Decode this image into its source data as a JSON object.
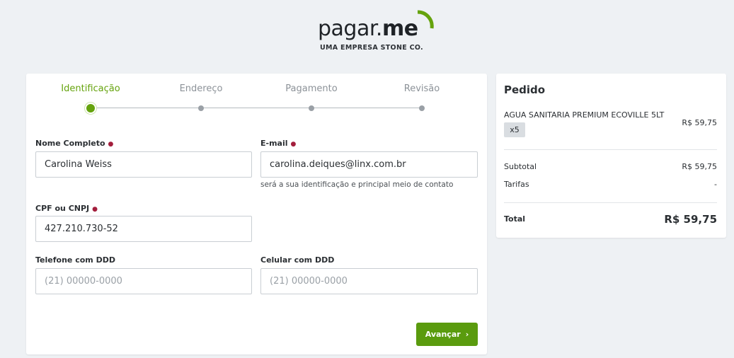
{
  "header": {
    "logo_word_1": "pagar.",
    "logo_word_2": "me",
    "logo_subtitle": "UMA EMPRESA STONE CO."
  },
  "stepper": {
    "steps": [
      {
        "label": "Identificação",
        "active": true
      },
      {
        "label": "Endereço",
        "active": false
      },
      {
        "label": "Pagamento",
        "active": false
      },
      {
        "label": "Revisão",
        "active": false
      }
    ]
  },
  "form": {
    "full_name": {
      "label": "Nome Completo",
      "required_mark": "●",
      "value": "Carolina Weiss"
    },
    "email": {
      "label": "E-mail",
      "required_mark": "●",
      "value": "carolina.deiques@linx.com.br",
      "help": "será a sua identificação e principal meio de contato"
    },
    "cpf": {
      "label": "CPF ou CNPJ",
      "required_mark": "●",
      "value": "427.210.730-52"
    },
    "phone": {
      "label": "Telefone com DDD",
      "value": "",
      "placeholder": "(21) 00000-0000"
    },
    "mobile": {
      "label": "Celular com DDD",
      "value": "",
      "placeholder": "(21) 00000-0000"
    },
    "submit_label": "Avançar",
    "submit_icon": "chevron-right-icon"
  },
  "order": {
    "title": "Pedido",
    "item": {
      "name": "AGUA SANITARIA PREMIUM ECOVILLE 5LT",
      "qty": "x5",
      "price": "R$ 59,75"
    },
    "subtotal_label": "Subtotal",
    "subtotal_value": "R$ 59,75",
    "fees_label": "Tarifas",
    "fees_value": "-",
    "total_label": "Total",
    "total_value": "R$ 59,75"
  },
  "colors": {
    "accent": "#65a30d",
    "button": "#5a9b0e",
    "required": "#a31e3c",
    "background": "#eef1f4"
  }
}
